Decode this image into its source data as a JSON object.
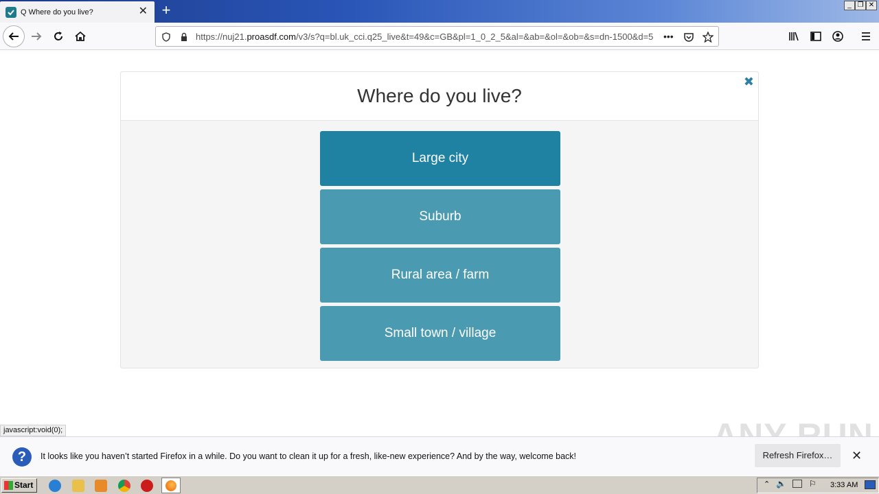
{
  "browser": {
    "tab_title": "Q Where do you live?",
    "url_prefix": "https://nuj21.",
    "url_domain": "proasdf.com",
    "url_rest": "/v3/s?q=bl.uk_cci.q25_live&t=49&c=GB&pl=1_0_2_5&al=&ab=&ol=&ob=&s=dn-1500&d=5",
    "url_more": "•••"
  },
  "survey": {
    "question": "Where do you live?",
    "options": [
      "Large city",
      "Suburb",
      "Rural area / farm",
      "Small town / village"
    ],
    "hover_index": 0
  },
  "status_text": "javascript:void(0);",
  "notification": {
    "message": "It looks like you haven’t started Firefox in a while. Do you want to clean it up for a fresh, like-new experience? And by the way, welcome back!",
    "button_label": "Refresh Firefox…"
  },
  "watermark": "ANY RUN",
  "taskbar": {
    "start_label": "Start",
    "clock": "3:33 AM"
  },
  "colors": {
    "option_bg": "#4a9ab2",
    "option_hover_bg": "#1f82a2",
    "close_x": "#2e7ea6"
  }
}
